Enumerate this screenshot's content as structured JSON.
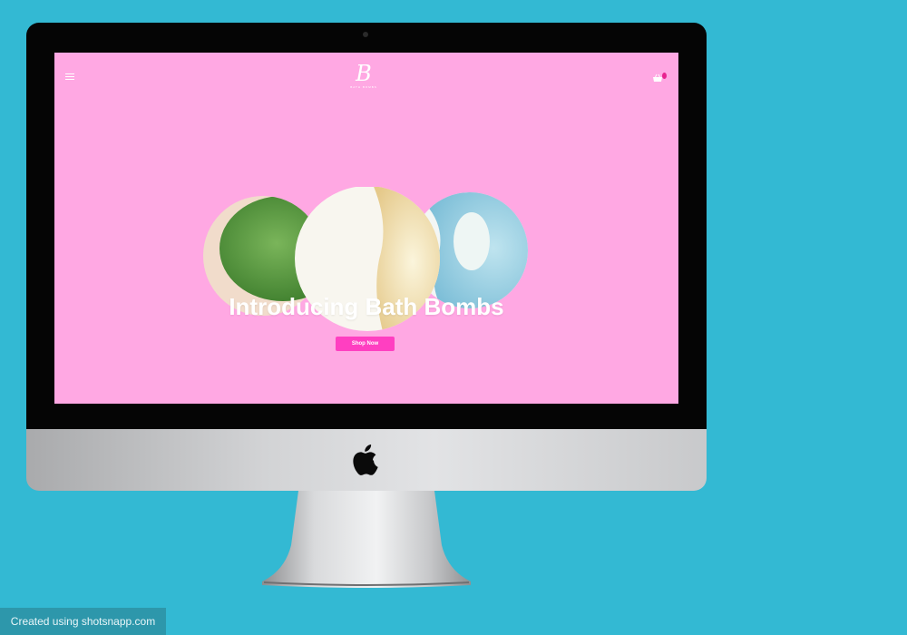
{
  "brand": {
    "logo_letter": "B",
    "logo_tagline": "BATH BOMBS"
  },
  "icons": {
    "menu": "hamburger-menu-icon",
    "cart": "shopping-basket-icon",
    "apple": "apple-logo-icon"
  },
  "hero": {
    "title": "Introducing Bath Bombs",
    "cta_label": "Shop Now"
  },
  "colors": {
    "page_background": "#33b9d3",
    "screen_background": "#ffa8e3",
    "cta_background": "#ff3fc1",
    "cart_badge": "#e8238f"
  },
  "watermark": {
    "text": "Created using shotsnapp.com"
  }
}
